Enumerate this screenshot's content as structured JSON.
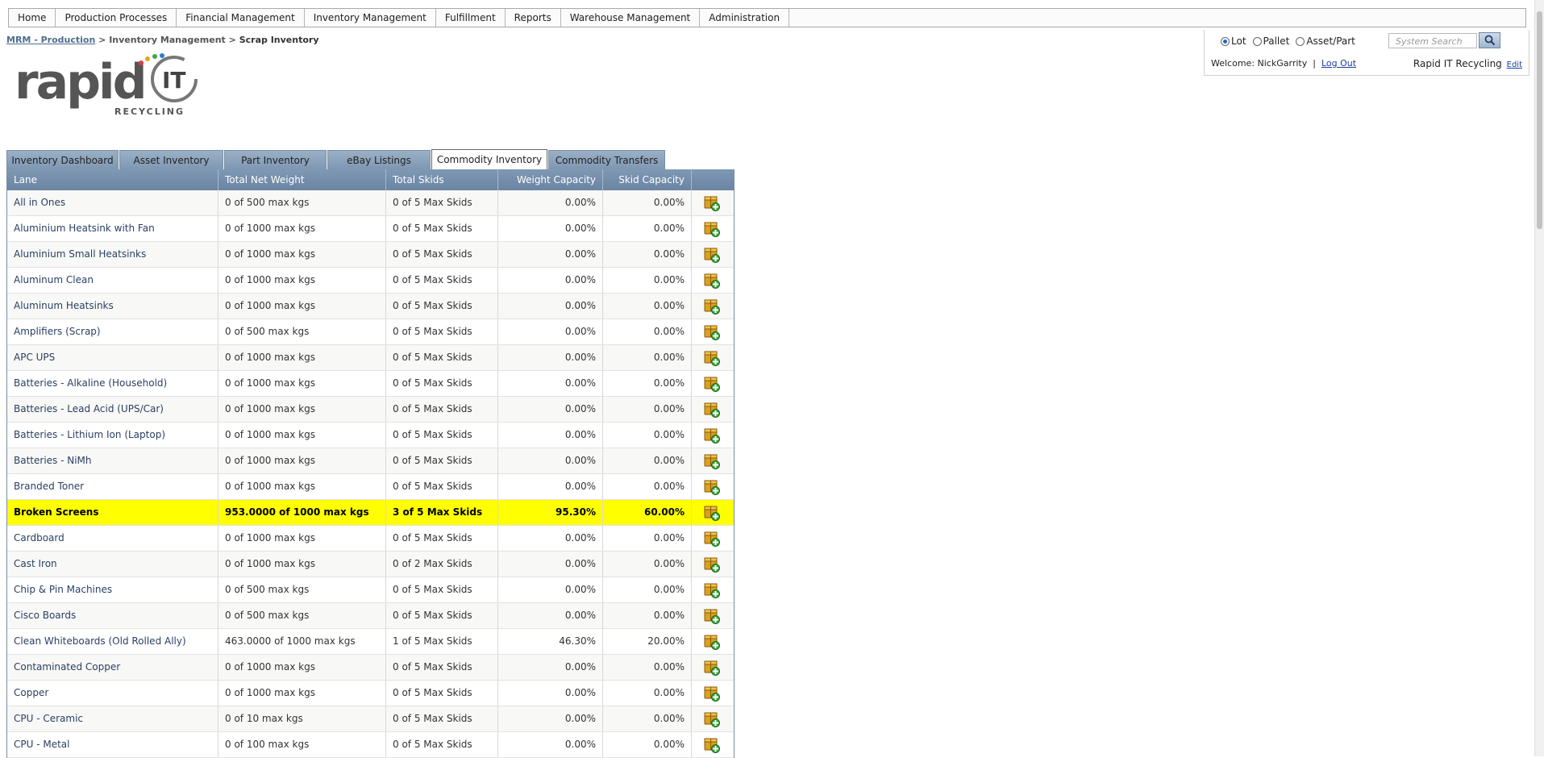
{
  "nav": {
    "items": [
      {
        "label": "Home"
      },
      {
        "label": "Production Processes"
      },
      {
        "label": "Financial Management"
      },
      {
        "label": "Inventory Management"
      },
      {
        "label": "Fulfillment"
      },
      {
        "label": "Reports"
      },
      {
        "label": "Warehouse Management"
      },
      {
        "label": "Administration"
      }
    ]
  },
  "breadcrumb": {
    "root": "MRM - Production",
    "sep": ">",
    "parent": "Inventory Management",
    "current": "Scrap Inventory"
  },
  "logo": {
    "main": "rapid",
    "suffix": "IT",
    "sub": "RECYCLING"
  },
  "user_panel": {
    "radios": [
      {
        "label": "Lot",
        "checked": true
      },
      {
        "label": "Pallet",
        "checked": false
      },
      {
        "label": "Asset/Part",
        "checked": false
      }
    ],
    "search_placeholder": "System Search",
    "welcome_text": "Welcome: NickGarrity",
    "divider": "|",
    "logout": "Log Out",
    "company": "Rapid IT Recycling",
    "edit": "Edit"
  },
  "tabs": [
    {
      "label": "Inventory Dashboard",
      "active": false
    },
    {
      "label": "Asset Inventory",
      "active": false
    },
    {
      "label": "Part Inventory",
      "active": false
    },
    {
      "label": "eBay Listings",
      "active": false
    },
    {
      "label": "Commodity Inventory",
      "active": true
    },
    {
      "label": "Commodity Transfers",
      "active": false
    }
  ],
  "table": {
    "headers": {
      "lane": "Lane",
      "weight": "Total Net Weight",
      "skids": "Total Skids",
      "wcap": "Weight Capacity",
      "scap": "Skid Capacity"
    },
    "rows": [
      {
        "lane": "All in Ones",
        "weight": "0 of 500 max kgs",
        "skids": "0 of 5 Max Skids",
        "wcap": "0.00%",
        "scap": "0.00%",
        "highlight": false
      },
      {
        "lane": "Aluminium Heatsink with Fan",
        "weight": "0 of 1000 max kgs",
        "skids": "0 of 5 Max Skids",
        "wcap": "0.00%",
        "scap": "0.00%",
        "highlight": false
      },
      {
        "lane": "Aluminium Small Heatsinks",
        "weight": "0 of 1000 max kgs",
        "skids": "0 of 5 Max Skids",
        "wcap": "0.00%",
        "scap": "0.00%",
        "highlight": false
      },
      {
        "lane": "Aluminum Clean",
        "weight": "0 of 1000 max kgs",
        "skids": "0 of 5 Max Skids",
        "wcap": "0.00%",
        "scap": "0.00%",
        "highlight": false
      },
      {
        "lane": "Aluminum Heatsinks",
        "weight": "0 of 1000 max kgs",
        "skids": "0 of 5 Max Skids",
        "wcap": "0.00%",
        "scap": "0.00%",
        "highlight": false
      },
      {
        "lane": "Amplifiers (Scrap)",
        "weight": "0 of 500 max kgs",
        "skids": "0 of 5 Max Skids",
        "wcap": "0.00%",
        "scap": "0.00%",
        "highlight": false
      },
      {
        "lane": "APC UPS",
        "weight": "0 of 1000 max kgs",
        "skids": "0 of 5 Max Skids",
        "wcap": "0.00%",
        "scap": "0.00%",
        "highlight": false
      },
      {
        "lane": "Batteries - Alkaline (Household)",
        "weight": "0 of 1000 max kgs",
        "skids": "0 of 5 Max Skids",
        "wcap": "0.00%",
        "scap": "0.00%",
        "highlight": false
      },
      {
        "lane": "Batteries - Lead Acid (UPS/Car)",
        "weight": "0 of 1000 max kgs",
        "skids": "0 of 5 Max Skids",
        "wcap": "0.00%",
        "scap": "0.00%",
        "highlight": false
      },
      {
        "lane": "Batteries - Lithium Ion (Laptop)",
        "weight": "0 of 1000 max kgs",
        "skids": "0 of 5 Max Skids",
        "wcap": "0.00%",
        "scap": "0.00%",
        "highlight": false
      },
      {
        "lane": "Batteries - NiMh",
        "weight": "0 of 1000 max kgs",
        "skids": "0 of 5 Max Skids",
        "wcap": "0.00%",
        "scap": "0.00%",
        "highlight": false
      },
      {
        "lane": "Branded Toner",
        "weight": "0 of 1000 max kgs",
        "skids": "0 of 5 Max Skids",
        "wcap": "0.00%",
        "scap": "0.00%",
        "highlight": false
      },
      {
        "lane": "Broken Screens",
        "weight": "953.0000 of 1000 max kgs",
        "skids": "3 of 5 Max Skids",
        "wcap": "95.30%",
        "scap": "60.00%",
        "highlight": true
      },
      {
        "lane": "Cardboard",
        "weight": "0 of 1000 max kgs",
        "skids": "0 of 5 Max Skids",
        "wcap": "0.00%",
        "scap": "0.00%",
        "highlight": false
      },
      {
        "lane": "Cast Iron",
        "weight": "0 of 1000 max kgs",
        "skids": "0 of 2 Max Skids",
        "wcap": "0.00%",
        "scap": "0.00%",
        "highlight": false
      },
      {
        "lane": "Chip & Pin Machines",
        "weight": "0 of 500 max kgs",
        "skids": "0 of 5 Max Skids",
        "wcap": "0.00%",
        "scap": "0.00%",
        "highlight": false
      },
      {
        "lane": "Cisco Boards",
        "weight": "0 of 500 max kgs",
        "skids": "0 of 5 Max Skids",
        "wcap": "0.00%",
        "scap": "0.00%",
        "highlight": false
      },
      {
        "lane": "Clean Whiteboards (Old Rolled Ally)",
        "weight": "463.0000 of 1000 max kgs",
        "skids": "1 of 5 Max Skids",
        "wcap": "46.30%",
        "scap": "20.00%",
        "highlight": false
      },
      {
        "lane": "Contaminated Copper",
        "weight": "0 of 1000 max kgs",
        "skids": "0 of 5 Max Skids",
        "wcap": "0.00%",
        "scap": "0.00%",
        "highlight": false
      },
      {
        "lane": "Copper",
        "weight": "0 of 1000 max kgs",
        "skids": "0 of 5 Max Skids",
        "wcap": "0.00%",
        "scap": "0.00%",
        "highlight": false
      },
      {
        "lane": "CPU - Ceramic",
        "weight": "0 of 10 max kgs",
        "skids": "0 of 5 Max Skids",
        "wcap": "0.00%",
        "scap": "0.00%",
        "highlight": false
      },
      {
        "lane": "CPU - Metal",
        "weight": "0 of 100 max kgs",
        "skids": "0 of 5 Max Skids",
        "wcap": "0.00%",
        "scap": "0.00%",
        "highlight": false
      }
    ]
  },
  "colors": {
    "highlight": "#ffff00",
    "header_bg": "#7590ae",
    "link": "#1a3ea8"
  }
}
